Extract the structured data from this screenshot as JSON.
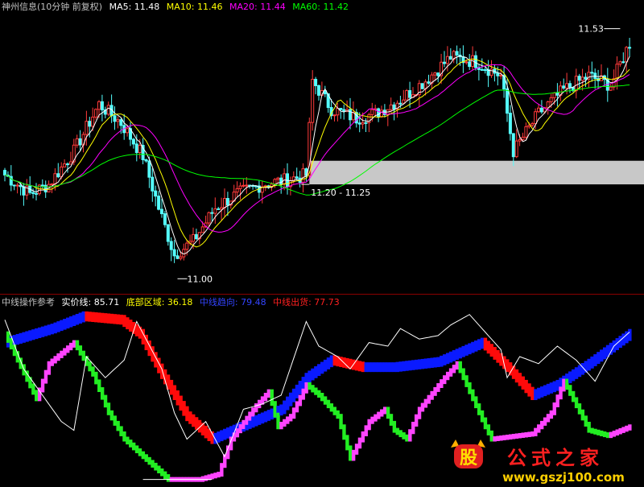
{
  "top_legend": {
    "title": "神州信息(10分钟 前复权)",
    "ma5": "MA5: 11.48",
    "ma10": "MA10: 11.46",
    "ma20": "MA20: 11.44",
    "ma60": "MA60: 11.42"
  },
  "bottom_legend": {
    "title": "中线操作参考",
    "price_line": "实价线: 85.71",
    "bottom_zone": "底部区域: 36.18",
    "trend_line": "中线趋向: 79.48",
    "exit_line": "中线出货: 77.73"
  },
  "annotations": {
    "high_label": "11.53",
    "low_label": "11.00",
    "zone_label": "11.20 - 11.25"
  },
  "logo": {
    "char": "股",
    "text": "公式之家",
    "url": "www.gszj100.com"
  },
  "colors": {
    "background": "#000000",
    "up": "#ff3a3a",
    "down": "#54ffff",
    "ma5": "#ffffff",
    "ma10": "#ffff00",
    "ma20": "#ff00ff",
    "ma60": "#00ff00",
    "zone": "#c8c8c8",
    "blue": "#0a1aff",
    "red": "#ff0a0a",
    "green": "#22ee22",
    "magenta": "#ff44ff",
    "label_white": "#ffffff",
    "label_yellow": "#ffff00",
    "label_magenta": "#ff00ff",
    "label_green": "#00ff00",
    "label_blue": "#3344ff",
    "label_red": "#ff2020",
    "title_gray": "#c0c0c0"
  },
  "chart_data": [
    {
      "type": "candlestick",
      "title": "神州信息(10分钟 前复权)",
      "ylim": [
        10.98,
        11.56
      ],
      "high": 11.53,
      "low": 11.0,
      "zone": [
        11.2,
        11.25
      ],
      "ma_series": [
        {
          "name": "MA5",
          "value": 11.48
        },
        {
          "name": "MA10",
          "value": 11.46
        },
        {
          "name": "MA20",
          "value": 11.44
        },
        {
          "name": "MA60",
          "value": 11.42
        }
      ],
      "anchors": [
        [
          0,
          11.22
        ],
        [
          8,
          11.18
        ],
        [
          14,
          11.2
        ],
        [
          22,
          11.27
        ],
        [
          30,
          11.37
        ],
        [
          37,
          11.33
        ],
        [
          44,
          11.26
        ],
        [
          49,
          11.15
        ],
        [
          54,
          11.05
        ],
        [
          60,
          11.08
        ],
        [
          67,
          11.15
        ],
        [
          74,
          11.18
        ],
        [
          82,
          11.2
        ],
        [
          90,
          11.21
        ],
        [
          96,
          11.22
        ],
        [
          98,
          11.42
        ],
        [
          104,
          11.36
        ],
        [
          112,
          11.34
        ],
        [
          118,
          11.35
        ],
        [
          126,
          11.38
        ],
        [
          134,
          11.42
        ],
        [
          142,
          11.47
        ],
        [
          150,
          11.46
        ],
        [
          158,
          11.43
        ],
        [
          162,
          11.27
        ],
        [
          170,
          11.35
        ],
        [
          178,
          11.4
        ],
        [
          186,
          11.43
        ],
        [
          193,
          11.41
        ],
        [
          199,
          11.5
        ]
      ]
    },
    {
      "type": "line",
      "title": "中线操作参考",
      "ylim": [
        0,
        100
      ],
      "series": [
        {
          "name": "实价线",
          "value": 85.71
        },
        {
          "name": "底部区域",
          "value": 36.18
        },
        {
          "name": "中线趋向",
          "value": 79.48
        },
        {
          "name": "中线出货",
          "value": 77.73
        }
      ],
      "trend_anchors": [
        [
          0,
          80
        ],
        [
          15,
          88
        ],
        [
          25,
          95
        ],
        [
          37,
          93
        ],
        [
          43,
          85
        ],
        [
          50,
          62
        ],
        [
          58,
          38
        ],
        [
          66,
          25
        ],
        [
          75,
          32
        ],
        [
          88,
          42
        ],
        [
          96,
          60
        ],
        [
          104,
          70
        ],
        [
          114,
          66
        ],
        [
          124,
          66
        ],
        [
          138,
          69
        ],
        [
          152,
          80
        ],
        [
          160,
          66
        ],
        [
          168,
          50
        ],
        [
          176,
          56
        ],
        [
          186,
          68
        ],
        [
          199,
          85
        ]
      ],
      "fast_anchors": [
        [
          0,
          85
        ],
        [
          4,
          70
        ],
        [
          10,
          48
        ],
        [
          14,
          68
        ],
        [
          22,
          80
        ],
        [
          28,
          62
        ],
        [
          33,
          40
        ],
        [
          38,
          25
        ],
        [
          44,
          15
        ],
        [
          52,
          2
        ],
        [
          62,
          2
        ],
        [
          68,
          5
        ],
        [
          72,
          25
        ],
        [
          80,
          44
        ],
        [
          84,
          52
        ],
        [
          87,
          32
        ],
        [
          91,
          38
        ],
        [
          96,
          56
        ],
        [
          100,
          50
        ],
        [
          106,
          38
        ],
        [
          110,
          14
        ],
        [
          116,
          35
        ],
        [
          121,
          42
        ],
        [
          124,
          30
        ],
        [
          128,
          25
        ],
        [
          132,
          42
        ],
        [
          140,
          60
        ],
        [
          144,
          68
        ],
        [
          149,
          48
        ],
        [
          153,
          32
        ],
        [
          155,
          25
        ],
        [
          168,
          28
        ],
        [
          174,
          40
        ],
        [
          178,
          58
        ],
        [
          182,
          44
        ],
        [
          186,
          30
        ],
        [
          192,
          27
        ],
        [
          199,
          32
        ]
      ],
      "price_anchors": [
        [
          0,
          93
        ],
        [
          6,
          65
        ],
        [
          12,
          50
        ],
        [
          18,
          35
        ],
        [
          22,
          30
        ],
        [
          26,
          72
        ],
        [
          32,
          60
        ],
        [
          38,
          70
        ],
        [
          42,
          92
        ],
        [
          50,
          65
        ],
        [
          54,
          40
        ],
        [
          58,
          25
        ],
        [
          64,
          35
        ],
        [
          70,
          15
        ],
        [
          76,
          42
        ],
        [
          82,
          45
        ],
        [
          88,
          50
        ],
        [
          96,
          92
        ],
        [
          100,
          78
        ],
        [
          106,
          72
        ],
        [
          110,
          65
        ],
        [
          116,
          80
        ],
        [
          122,
          78
        ],
        [
          126,
          88
        ],
        [
          132,
          82
        ],
        [
          138,
          84
        ],
        [
          142,
          90
        ],
        [
          148,
          96
        ],
        [
          152,
          88
        ],
        [
          158,
          76
        ],
        [
          160,
          60
        ],
        [
          164,
          72
        ],
        [
          170,
          68
        ],
        [
          176,
          78
        ],
        [
          182,
          70
        ],
        [
          188,
          58
        ],
        [
          194,
          78
        ],
        [
          199,
          86
        ]
      ]
    }
  ]
}
